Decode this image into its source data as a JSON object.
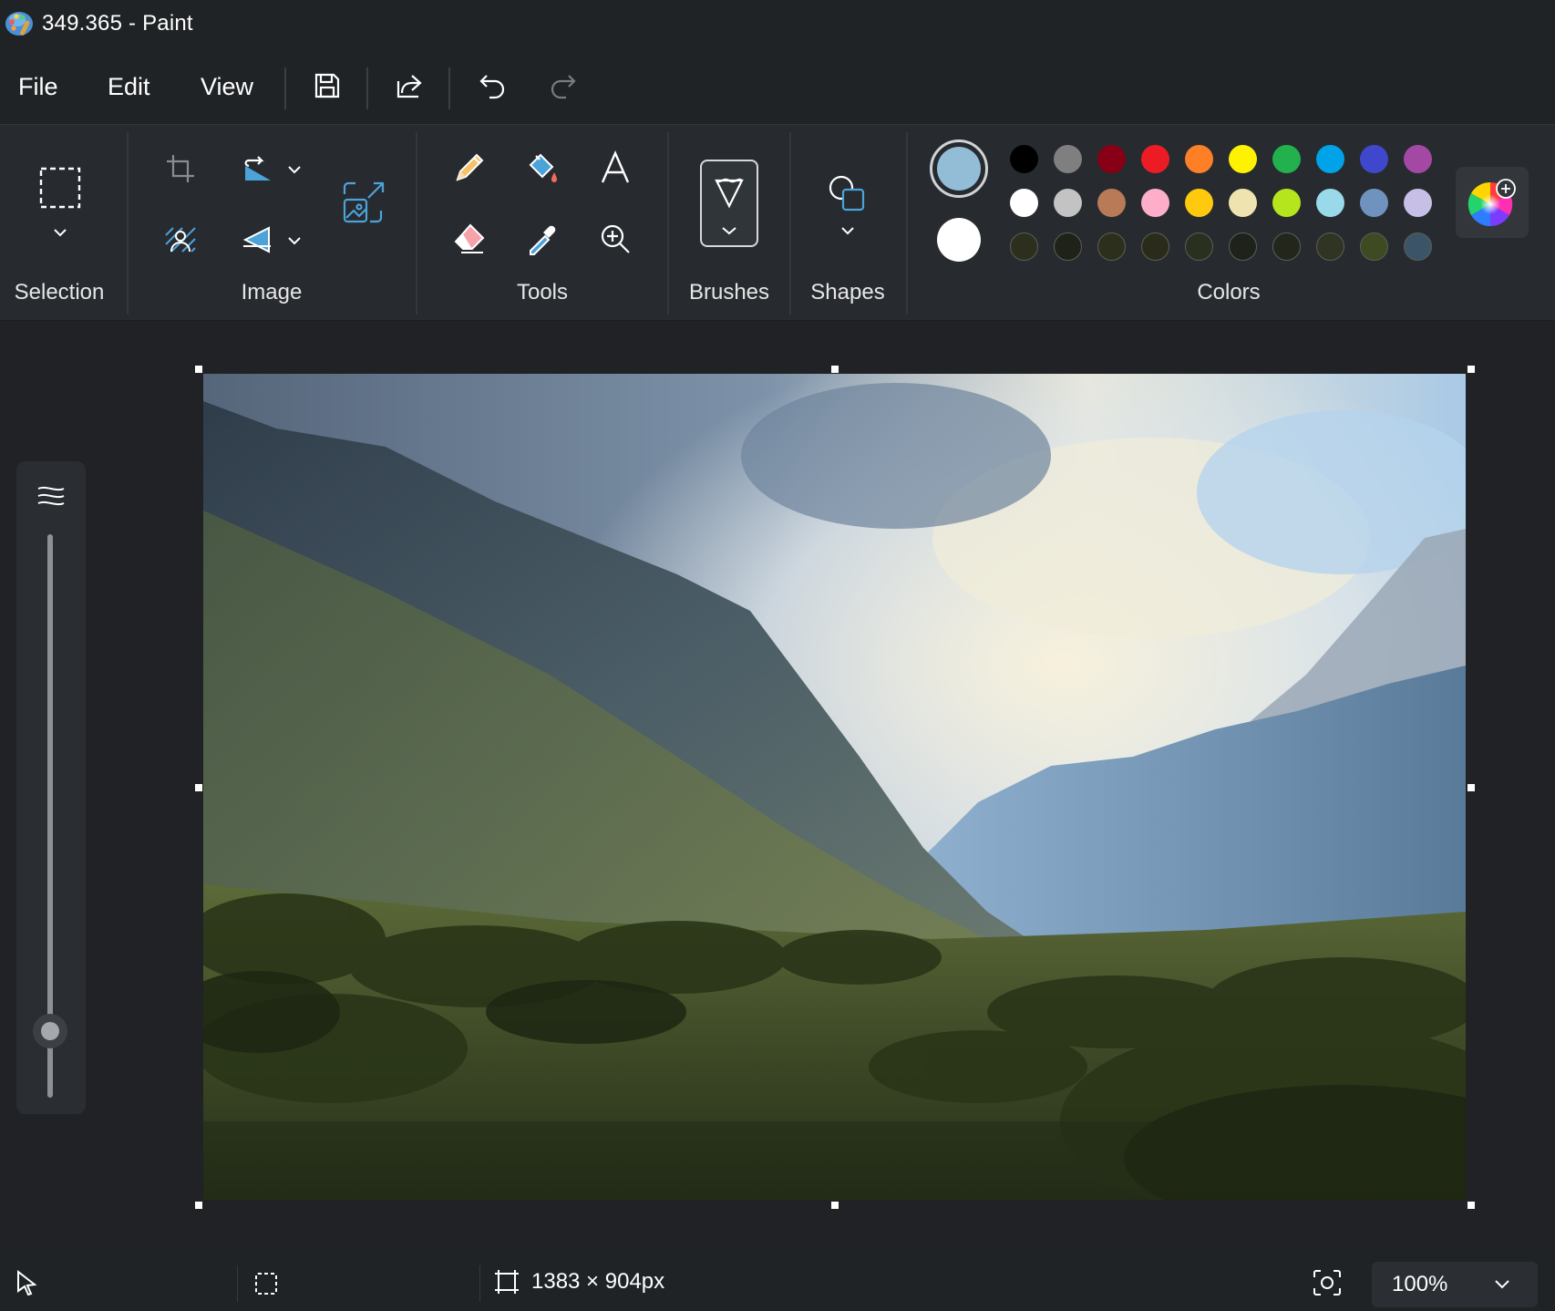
{
  "window": {
    "title": "349.365 - Paint"
  },
  "menu": {
    "file": "File",
    "edit": "Edit",
    "view": "View"
  },
  "ribbon": {
    "groups": {
      "selection": "Selection",
      "image": "Image",
      "tools": "Tools",
      "brushes": "Brushes",
      "shapes": "Shapes",
      "colors": "Colors"
    },
    "icons": [
      "selection-rectangle-icon",
      "crop-icon",
      "rotate-icon",
      "remove-background-icon",
      "flip-icon",
      "resize-icon",
      "pencil-icon",
      "fill-bucket-icon",
      "text-icon",
      "eraser-icon",
      "color-picker-icon",
      "magnifier-icon",
      "brush-icon",
      "shapes-icon",
      "edit-colors-icon"
    ]
  },
  "colors": {
    "primary": "#93bcd6",
    "secondary": "#ffffff",
    "palette": [
      [
        "#000000",
        "#7f7f7f",
        "#880015",
        "#ed1c24",
        "#ff7f27",
        "#fff200",
        "#22b14c",
        "#00a2e8",
        "#3f48cc",
        "#a349a4"
      ],
      [
        "#ffffff",
        "#c3c3c3",
        "#b97a57",
        "#ffaec9",
        "#ffc90e",
        "#efe4b0",
        "#b5e61d",
        "#99d9ea",
        "#7092be",
        "#c8bfe7"
      ],
      [
        "#2c2f1e",
        "#1f2218",
        "#2b2f1c",
        "#2a2b1a",
        "#2a3020",
        "#1e221a",
        "#23261a",
        "#2f3522",
        "#3d4a22",
        "#3b5468"
      ]
    ]
  },
  "status": {
    "canvas_size": "1383 × 904px",
    "zoom": "100%"
  }
}
